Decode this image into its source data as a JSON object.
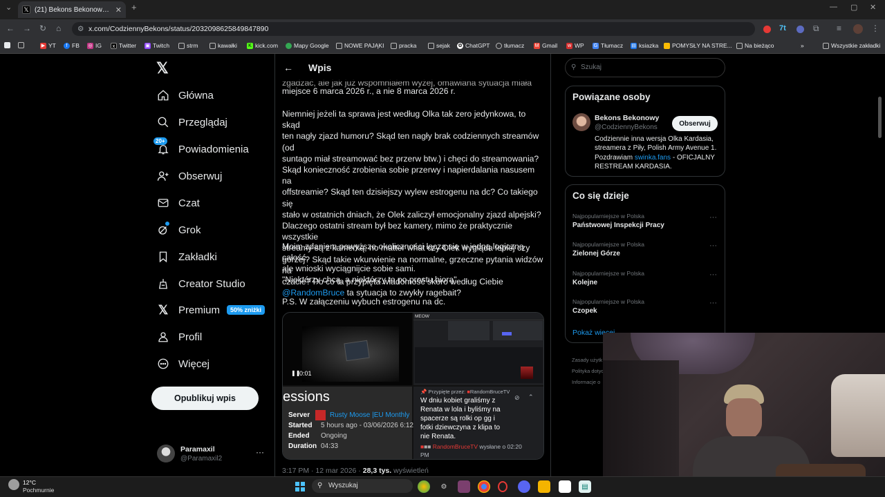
{
  "browser": {
    "tab_title": "(21) Bekons Bekonowy w serwi",
    "url": "x.com/CodziennyBekons/status/2032098625849847890",
    "bookmarks": [
      "YT",
      "FB",
      "IG",
      "Twitter",
      "Twitch",
      "strm",
      "kawałki",
      "kick.com",
      "Mapy Google",
      "NOWE PAJĄKI",
      "pracka",
      "sejak",
      "ChatGPT",
      "tłumacz",
      "Gmail",
      "WP",
      "Tłumacz",
      "ksiazka",
      "POMYSŁY NA STRE...",
      "Na bieżąco"
    ],
    "all_bookmarks": "Wszystkie zakładki"
  },
  "nav": {
    "home": "Główna",
    "explore": "Przeglądaj",
    "notifications": "Powiadomienia",
    "notif_badge": "20+",
    "follow": "Obserwuj",
    "chat": "Czat",
    "grok": "Grok",
    "bookmarks": "Zakładki",
    "creator": "Creator Studio",
    "premium": "Premium",
    "premium_badge": "50% zniżki",
    "profile": "Profil",
    "more": "Więcej",
    "post_button": "Opublikuj wpis"
  },
  "account": {
    "name": "Paramaxil",
    "handle": "@Paramaxil2"
  },
  "post": {
    "header": "Wpis",
    "p0a": "zgadzać, ale jak już wspomniałem wyżej, omawiana sytuacja miała",
    "p0b": "miejsce 6 marca 2026 r., a nie 8 marca 2026 r.",
    "p1_lines": [
      "Niemniej jeżeli ta sprawa jest według Olka tak zero jedynkowa, to skąd",
      "ten nagły zjazd humoru? Skąd ten nagły brak codziennych streamów (od",
      "suntago miał streamować bez przerw btw.) i chęci do streamowania?",
      "Skąd konieczność zrobienia sobie przerwy i napierdalania nasusem na",
      "offstreamie? Skąd ten dzisiejszy wylew estrogenu na dc? Co takiego się",
      "stało w ostatnich dniach, że Olek zaliczył emocjonalny zjazd alpejski?",
      "Dlaczego ostatni stream był bez kamery, mimo że praktycznie wszystkie",
      "streamy są z kamerką, no matter what czy Olek wygląda lepiej czy",
      "gorzej? Skąd takie wkurwienie na normalne, grzeczne pytania widzów na",
      "czacie? Po co ta przypięta wiadomość skoro według Ciebie"
    ],
    "mention": "@RandomBruce",
    "mention_tail": " ta sytuacja to zwykły ragebait?",
    "p2a": "Moim zdaniem powyższe okoliczności łączą się w jedną logiczną całość,",
    "p2b": "ale wnioski wyciągnijcie sobie sami.",
    "p3": "\"Niektórzy chcą, a niektórzy to po prostu biorą\".",
    "p4": "P.S. W załączeniu wybuch estrogenu na dc.",
    "meta_time": "3:17 PM · 12 mar 2026 ·",
    "meta_views": "28,3 tys.",
    "meta_views_label": "wyświetleń"
  },
  "media": {
    "video_time": "0:01",
    "meow": "MEOW",
    "sessions_title": "essions",
    "rows": [
      {
        "k": "Server",
        "v": "Rusty Moose |EU Monthly"
      },
      {
        "k": "Started",
        "v": "5 hours ago - 03/06/2026 6:12"
      },
      {
        "k": "Ended",
        "v": "Ongoing"
      },
      {
        "k": "Duration",
        "v": "04:33"
      }
    ],
    "pinned_by": "Przypięte przez:",
    "pinned_user": "RandomBruceTV",
    "pinned_lines": [
      "W dniu kobiet graliśmy z",
      "Renata w lola i byliśmy na",
      "spacerze są rolki op gg i",
      "fotki dziewczyna z klipa to",
      "nie Renata."
    ],
    "sent_user": "RandomBruceTV",
    "sent_at": "wysłane o 02:20",
    "sent_pm": "PM"
  },
  "right": {
    "search_placeholder": "Szukaj",
    "related_title": "Powiązane osoby",
    "person_name": "Bekons Bekonowy",
    "person_handle": "@CodziennyBekons",
    "follow_btn": "Obserwuj",
    "bio_lines": [
      "Codziennie inna wersja Olka Kardasia,",
      "streamera z Piły, Polish Army Avenue 1."
    ],
    "bio_l3_pre": "Pozdrawiam ",
    "bio_link": "swinka.fans",
    "bio_l3_post": " - OFICJALNY",
    "bio_l4": "RESTREAM KARDASIA.",
    "trends_title": "Co się dzieje",
    "trends": [
      {
        "cat": "Najpopularniejsze w Polska",
        "name": "Państwowej Inspekcji Pracy"
      },
      {
        "cat": "Najpopularniejsze w Polska",
        "name": "Zielonej Górze"
      },
      {
        "cat": "Najpopularniejsze w Polska",
        "name": "Kolejne"
      },
      {
        "cat": "Najpopularniejsze w Polska",
        "name": "Czopek"
      }
    ],
    "show_more": "Pokaż więcej",
    "footer": [
      "Zasady użytk",
      "Polityka dotyc",
      "Informacje o"
    ]
  },
  "taskbar": {
    "temp": "12°C",
    "weather": "Pochmurnie",
    "search": "Wyszukaj"
  }
}
